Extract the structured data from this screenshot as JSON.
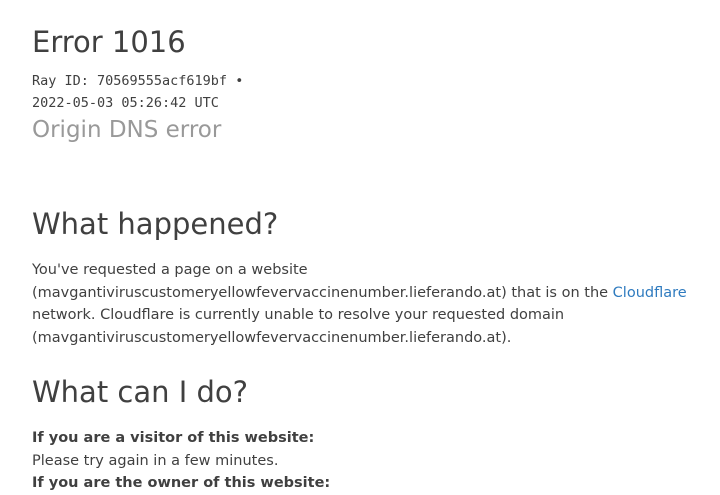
{
  "error": {
    "title": "Error 1016",
    "ray_line": "Ray ID: 70569555acf619bf •",
    "timestamp": "2022-05-03 05:26:42 UTC",
    "subtitle": "Origin DNS error"
  },
  "what_happened": {
    "heading": "What happened?",
    "text_before_link": "You've requested a page on a website (mavgantiviruscustomeryellowfevervaccinenumber.lieferando.at) that is on the ",
    "link_text": "Cloudflare",
    "text_after_link": " network. Cloudflare is currently unable to resolve your requested domain (mavgantiviruscustomeryellowfevervaccinenumber.lieferando.at)."
  },
  "what_can_i_do": {
    "heading": "What can I do?",
    "visitor_label": "If you are a visitor of this website:",
    "visitor_text": "Please try again in a few minutes.",
    "owner_label": "If you are the owner of this website:"
  }
}
